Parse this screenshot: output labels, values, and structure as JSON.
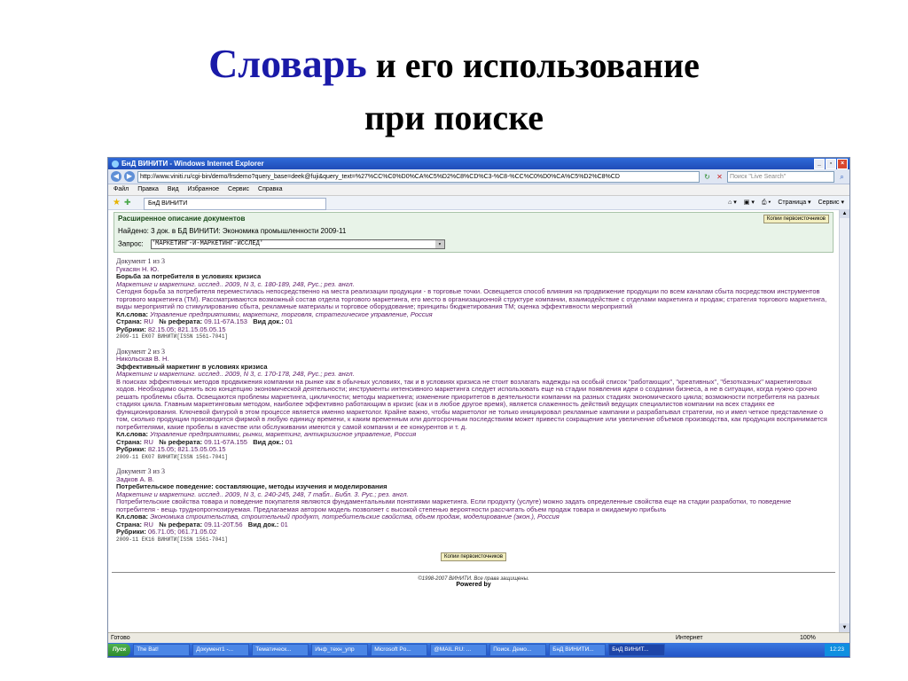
{
  "slide": {
    "title_big": "Словарь",
    "title_rest": " и его использование",
    "title_line2": "при поиске"
  },
  "browser": {
    "window_title": "БнД ВИНИТИ - Windows Internet Explorer",
    "url": "http://www.viniti.ru/cgi-bin/demo/frsdemo?query_base=deek@fuji&query_text=%27%CC%C0%D0%CA%C5%D2%C8%CD%C3-%C8-%CC%C0%D0%CA%C5%D2%C8%CD",
    "search_placeholder": "Поиск \"Live Search\"",
    "menu": [
      "Файл",
      "Правка",
      "Вид",
      "Избранное",
      "Сервис",
      "Справка"
    ],
    "tab_label": "БнД ВИНИТИ",
    "fav_tools": [
      "Страница ▾",
      "Сервис ▾"
    ]
  },
  "panel": {
    "title": "Расширенное описание документов",
    "found_prefix": "Найдено: ",
    "found_count": "3 док.",
    "found_rest": " в БД ВИНИТИ: ",
    "db_name": "Экономика промышленности 2009-11",
    "query_label": "Запрос:",
    "query_value": "'МАРКЕТИНГ-И-МАРКЕТИНГ-ИССЛЕД'",
    "copy_button": "Копии первоисточников"
  },
  "documents": [
    {
      "num": "Документ 1 из 3",
      "author": "Гукасян Н. Ю.",
      "title": "Борьба за потребителя в условиях кризиса",
      "source": "Маркетинг и маркетинг. исслед.. 2009, N 3, с. 180-189, 248, Рус.; рез. англ.",
      "abstract": "Сегодня борьба за потребителя переместилась непосредственно на места реализации продукции - в торговые точки. Освещается способ влияния на продвижение продукции по всем каналам сбыта посредством инструментов торгового маркетинга (ТМ). Рассматриваются возможный состав отдела торгового маркетинга, его место в организационной структуре компании, взаимодействие с отделами маркетинга и продаж; стратегия торгового маркетинга, виды мероприятий по стимулированию сбыта, рекламные материалы и торговое оборудование; принципы бюджетирования ТМ; оценка эффективности мероприятий",
      "kw_label": "Кл.слова:",
      "keywords": "Управление предприятиями, маркетинг, торговля, стратегическое управление, Россия",
      "country_label": "Страна:",
      "country": "RU",
      "ref_label": "№ реферата:",
      "ref": "09.11-67А.153",
      "type_label": "Вид док.:",
      "type": "01",
      "rub_label": "Рубрики:",
      "rubrics": "82.15.05; 821.15.05.05.15",
      "tag": "2009-11 ЕК07 ВИНИТИ[ISSN 1561-7041]"
    },
    {
      "num": "Документ 2 из 3",
      "author": "Никольская В. Н.",
      "title": "Эффективный маркетинг в условиях кризиса",
      "source": "Маркетинг и маркетинг. исслед.. 2009, N 3, с. 170-178, 248, Рус.; рез. англ.",
      "abstract": "В поисках эффективных методов продвижения компании на рынке как в обычных условиях, так и в условиях кризиса не стоит возлагать надежды на особый список \"работающих\", \"креативных\", \"безотказных\" маркетинговых ходов. Необходимо оценить всю концепцию экономической деятельности; инструменты интенсивного маркетинга следует использовать еще на стадии появления идеи о создании бизнеса, а не в ситуации, когда нужно срочно решать проблемы сбыта. Освещаются проблемы маркетинга, цикличности; методы маркетинга; изменение приоритетов в деятельности компании на разных стадиях экономического цикла; возможности потребителя на разных стадиях цикла. Главным маркетинговым методом, наиболее эффективно работающим в кризис (как и в любое другое время), является слаженность действий ведущих специалистов компании на всех стадиях ее функционирования. Ключевой фигурой в этом процессе является именно маркетолог. Крайне важно, чтобы маркетолог не только инициировал рекламные кампании и разрабатывал стратегии, но и имел четкое представление о том, сколько продукции производится фирмой в любую единицу времени, к каким временным или долгосрочным последствиям может привести сокращение или увеличение объемов производства, как продукция воспринимается потребителями, какие пробелы в качестве или обслуживании имеются у самой компании и ее конкурентов и т. д.",
      "kw_label": "Кл.слова:",
      "keywords": "Управление предприятиями, рынки, маркетинг, антикризисное управление, Россия",
      "country_label": "Страна:",
      "country": "RU",
      "ref_label": "№ реферата:",
      "ref": "09.11-67А.155",
      "type_label": "Вид док.:",
      "type": "01",
      "rub_label": "Рубрики:",
      "rubrics": "82.15.05; 821.15.05.05.15",
      "tag": "2009-11 ЕК07 ВИНИТИ[ISSN 1561-7041]"
    },
    {
      "num": "Документ 3 из 3",
      "author": "Задков А. В.",
      "title": "Потребительское поведение: составляющие, методы изучения и моделирования",
      "source": "Маркетинг и маркетинг. исслед.. 2009, N 3, с. 240-245, 248, 7 табл.. Библ. 3. Рус.; рез. англ.",
      "abstract": "Потребительские свойства товара и поведение покупателя являются фундаментальными понятиями маркетинга. Если продукту (услуге) можно задать определенные свойства еще на стадии разработки, то поведение потребителя - вещь труднопрогнозируемая. Предлагаемая автором модель позволяет с высокой степенью вероятности рассчитать объем продаж товара и ожидаемую прибыль",
      "kw_label": "Кл.слова:",
      "keywords": "Экономика строительства, строительный продукт, потребительские свойства, объем продаж, моделирование (экон.), Россия",
      "country_label": "Страна:",
      "country": "RU",
      "ref_label": "№ реферата:",
      "ref": "09.11-20Т.56",
      "type_label": "Вид док.:",
      "type": "01",
      "rub_label": "Рубрики:",
      "rubrics": "06.71.05; 061.71.05.02",
      "tag": "2009-11 ЕК16 ВИНИТИ[ISSN 1561-7041]"
    }
  ],
  "footer": {
    "copyright": "©1998-2007 ВИНИТИ. Все права защищены.",
    "powered": "Powered by"
  },
  "status": {
    "ready": "Готово",
    "zone": "Интернет",
    "zoom": "100%"
  },
  "taskbar": {
    "start": "Пуск",
    "tasks": [
      "The Bat!",
      "Документ1 -...",
      "Тематическ...",
      "Инф_техн_упр",
      "Microsoft Po...",
      "@MAIL.RU: ...",
      "Поиск. Демо...",
      "БнД ВИНИТИ...",
      "БнД ВИНИТ..."
    ],
    "clock": "12:23"
  }
}
